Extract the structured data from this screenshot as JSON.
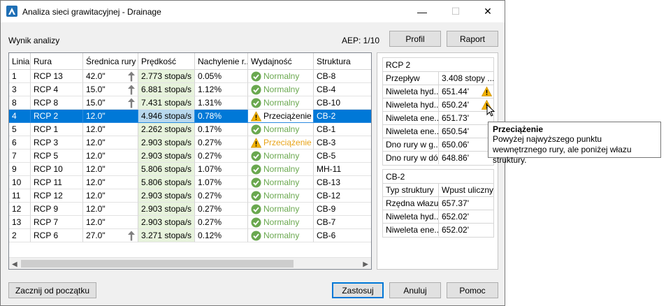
{
  "window": {
    "title": "Analiza sieci grawitacyjnej - Drainage",
    "minimize": "—",
    "maximize": "☐",
    "close": "✕"
  },
  "header": {
    "label": "Wynik analizy",
    "aep": "AEP: 1/10",
    "profil": "Profil",
    "raport": "Raport"
  },
  "grid": {
    "columns": [
      "Linia",
      "Rura",
      "Średnica rury",
      "Prędkość",
      "Nachylenie r...",
      "Wydajność",
      "Struktura"
    ],
    "rows": [
      {
        "linia": "1",
        "rura": "RCP 13",
        "srednica": "42.0\"",
        "arrow": true,
        "predkosc": "2.773 stopa/s",
        "nachylenie": "0.05%",
        "wydajnosc": "Normalny",
        "status": "ok",
        "struktura": "CB-8"
      },
      {
        "linia": "3",
        "rura": "RCP 4",
        "srednica": "15.0\"",
        "arrow": true,
        "predkosc": "6.881 stopa/s",
        "nachylenie": "1.12%",
        "wydajnosc": "Normalny",
        "status": "ok",
        "struktura": "CB-4"
      },
      {
        "linia": "8",
        "rura": "RCP 8",
        "srednica": "15.0\"",
        "arrow": true,
        "predkosc": "7.431 stopa/s",
        "nachylenie": "1.31%",
        "wydajnosc": "Normalny",
        "status": "ok",
        "struktura": "CB-10"
      },
      {
        "linia": "4",
        "rura": "RCP 2",
        "srednica": "12.0\"",
        "arrow": false,
        "predkosc": "4.946 stopa/s",
        "nachylenie": "0.78%",
        "wydajnosc": "Przeciążenie",
        "status": "warn",
        "struktura": "CB-2",
        "selected": true
      },
      {
        "linia": "5",
        "rura": "RCP 1",
        "srednica": "12.0\"",
        "arrow": false,
        "predkosc": "2.262 stopa/s",
        "nachylenie": "0.17%",
        "wydajnosc": "Normalny",
        "status": "ok",
        "struktura": "CB-1"
      },
      {
        "linia": "6",
        "rura": "RCP 3",
        "srednica": "12.0\"",
        "arrow": false,
        "predkosc": "2.903 stopa/s",
        "nachylenie": "0.27%",
        "wydajnosc": "Przeciążenie",
        "status": "warn",
        "struktura": "CB-3"
      },
      {
        "linia": "7",
        "rura": "RCP 5",
        "srednica": "12.0\"",
        "arrow": false,
        "predkosc": "2.903 stopa/s",
        "nachylenie": "0.27%",
        "wydajnosc": "Normalny",
        "status": "ok",
        "struktura": "CB-5"
      },
      {
        "linia": "9",
        "rura": "RCP 10",
        "srednica": "12.0\"",
        "arrow": false,
        "predkosc": "5.806 stopa/s",
        "nachylenie": "1.07%",
        "wydajnosc": "Normalny",
        "status": "ok",
        "struktura": "MH-11"
      },
      {
        "linia": "10",
        "rura": "RCP 11",
        "srednica": "12.0\"",
        "arrow": false,
        "predkosc": "5.806 stopa/s",
        "nachylenie": "1.07%",
        "wydajnosc": "Normalny",
        "status": "ok",
        "struktura": "CB-13"
      },
      {
        "linia": "11",
        "rura": "RCP 12",
        "srednica": "12.0\"",
        "arrow": false,
        "predkosc": "2.903 stopa/s",
        "nachylenie": "0.27%",
        "wydajnosc": "Normalny",
        "status": "ok",
        "struktura": "CB-12"
      },
      {
        "linia": "12",
        "rura": "RCP 9",
        "srednica": "12.0\"",
        "arrow": false,
        "predkosc": "2.903 stopa/s",
        "nachylenie": "0.27%",
        "wydajnosc": "Normalny",
        "status": "ok",
        "struktura": "CB-9"
      },
      {
        "linia": "13",
        "rura": "RCP 7",
        "srednica": "12.0\"",
        "arrow": false,
        "predkosc": "2.903 stopa/s",
        "nachylenie": "0.27%",
        "wydajnosc": "Normalny",
        "status": "ok",
        "struktura": "CB-7"
      },
      {
        "linia": "2",
        "rura": "RCP 6",
        "srednica": "27.0\"",
        "arrow": true,
        "predkosc": "3.271 stopa/s",
        "nachylenie": "0.12%",
        "wydajnosc": "Normalny",
        "status": "ok",
        "struktura": "CB-6"
      }
    ]
  },
  "pipe_panel": {
    "title": "RCP 2",
    "rows": [
      {
        "key": "Przepływ",
        "value": "3.408 stopy ...",
        "warn": false
      },
      {
        "key": "Niweleta hyd...",
        "value": "651.44'",
        "warn": true
      },
      {
        "key": "Niweleta hyd...",
        "value": "650.24'",
        "warn": true
      },
      {
        "key": "Niweleta ene...",
        "value": "651.73'",
        "warn": false
      },
      {
        "key": "Niweleta ene...",
        "value": "650.54'",
        "warn": false
      },
      {
        "key": "Dno rury w g...",
        "value": "650.06'",
        "warn": false
      },
      {
        "key": "Dno rury w dół",
        "value": "648.86'",
        "warn": false
      }
    ]
  },
  "structure_panel": {
    "title": "CB-2",
    "rows": [
      {
        "key": "Typ struktury",
        "value": "Wpust uliczny"
      },
      {
        "key": "Rzędna włazu",
        "value": "657.37'"
      },
      {
        "key": "Niweleta hyd...",
        "value": "652.02'"
      },
      {
        "key": "Niweleta ene...",
        "value": "652.02'"
      }
    ]
  },
  "tooltip": {
    "title": "Przeciążenie",
    "body": "Powyżej najwyższego punktu wewnętrznego rury, ale poniżej włazu struktury."
  },
  "footer": {
    "reset": "Zacznij od początku",
    "apply": "Zastosuj",
    "cancel": "Anuluj",
    "help": "Pomoc"
  },
  "colors": {
    "selection": "#0078d7",
    "normal": "#6aa84f",
    "warning": "#e8a317",
    "velocity_bg": "#e7f3dc"
  }
}
